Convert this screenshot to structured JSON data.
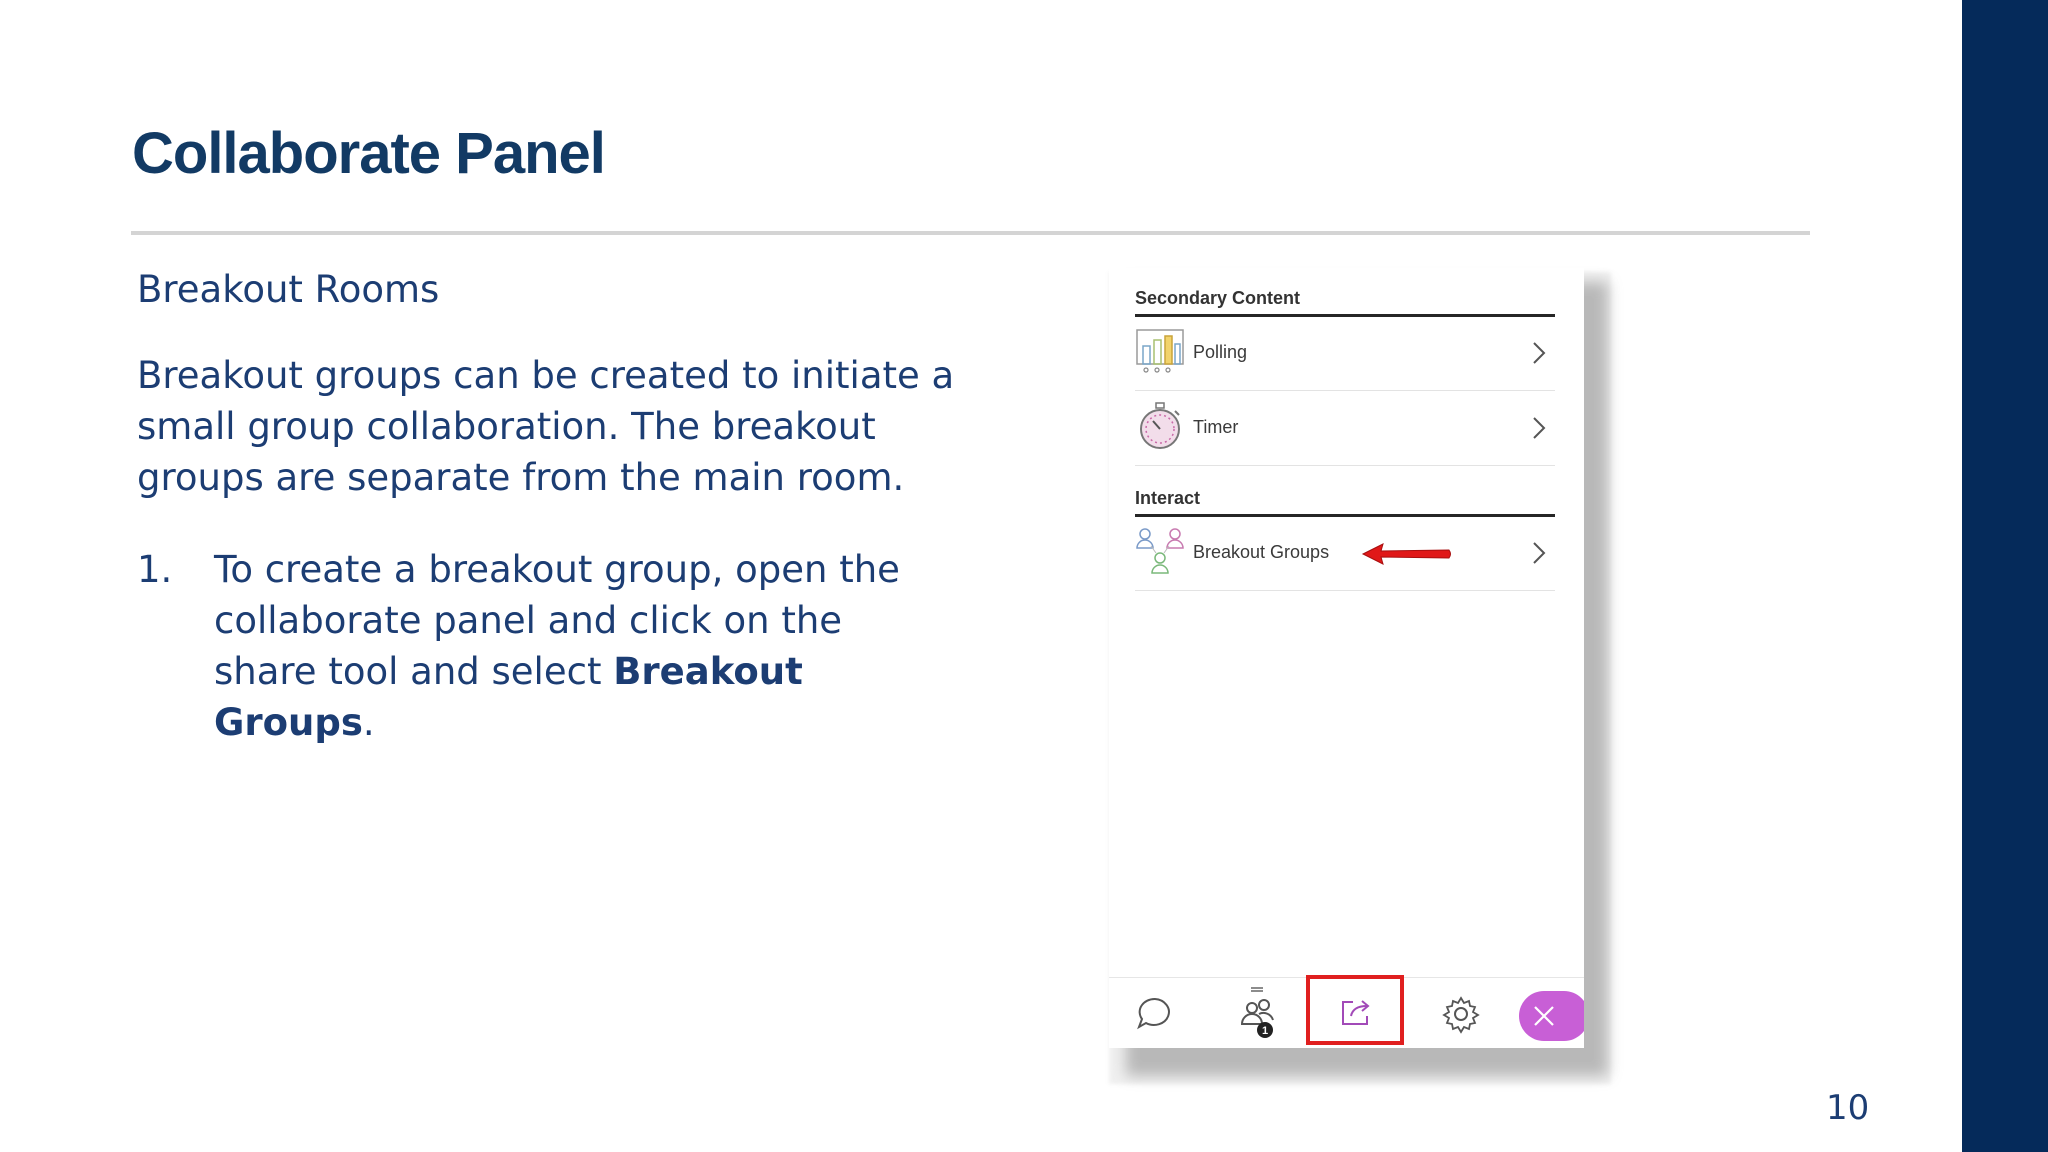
{
  "slide": {
    "title": "Collaborate Panel",
    "subheading": "Breakout Rooms",
    "paragraph": "Breakout groups can be created to initiate a small group collaboration.  The breakout groups are separate from the main room.",
    "step": {
      "number": "1.",
      "text_before": "To create a breakout group, open the collaborate panel and click on the share tool and select ",
      "bold": "Breakout Groups",
      "text_after": "."
    },
    "page_number": "10"
  },
  "panel": {
    "secondary_content_label": "Secondary Content",
    "items_secondary": [
      {
        "label": "Polling",
        "icon": "polling-icon"
      },
      {
        "label": "Timer",
        "icon": "timer-icon"
      }
    ],
    "interact_label": "Interact",
    "items_interact": [
      {
        "label": "Breakout Groups",
        "icon": "breakout-groups-icon"
      }
    ],
    "toolbar": {
      "icons": [
        "chat-icon",
        "attendees-icon",
        "share-content-icon",
        "settings-icon",
        "close-icon"
      ],
      "attendee_badge": "1"
    }
  },
  "colors": {
    "title": "#123a64",
    "body_text": "#1c3d73",
    "sidebar": "#052a5a",
    "highlight_box": "#e01f1f",
    "close_button": "#c85fd6"
  }
}
